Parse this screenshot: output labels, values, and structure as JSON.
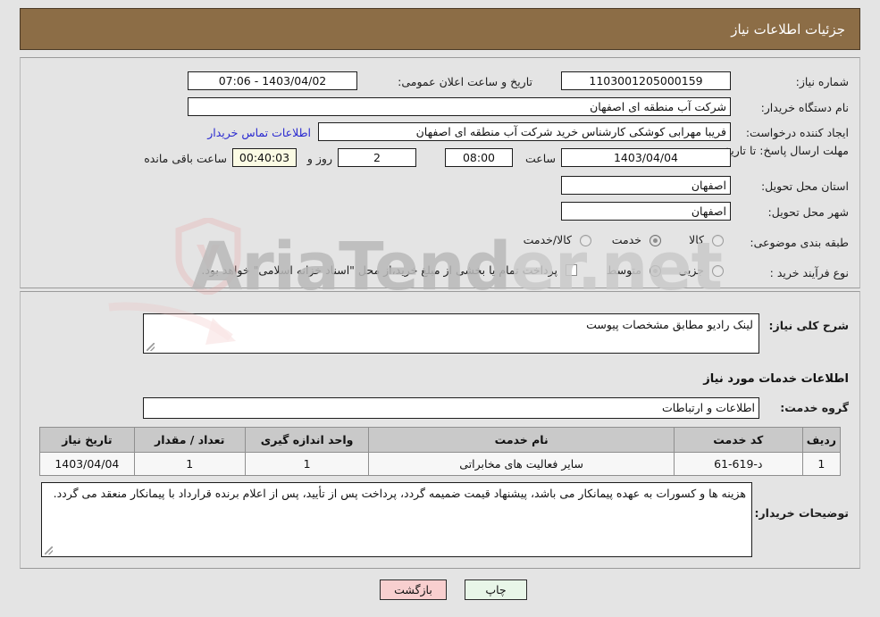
{
  "header": {
    "title": "جزئیات اطلاعات نیاز"
  },
  "top_section": {
    "need_number": {
      "label": "شماره نیاز:",
      "value": "1103001205000159"
    },
    "public_announce": {
      "label": "تاریخ و ساعت اعلان عمومی:",
      "value": "1403/04/02 - 07:06"
    },
    "buyer_org": {
      "label": "نام دستگاه خریدار:",
      "value": "شرکت آب منطقه ای اصفهان"
    },
    "requester": {
      "label": "ایجاد کننده درخواست:",
      "value": "فریبا مهرابی کوشکی کارشناس خرید شرکت آب منطقه ای اصفهان"
    },
    "contact_link": {
      "label": "اطلاعات تماس خریدار"
    },
    "deadline": {
      "label": "مهلت ارسال پاسخ: تا تاریخ:",
      "date": "1403/04/04",
      "time_label": "ساعت",
      "time": "08:00",
      "days": "2",
      "days_label": "روز و",
      "countdown": "00:40:03",
      "remaining_label": "ساعت باقی مانده"
    },
    "province": {
      "label": "استان محل تحویل:",
      "value": "اصفهان"
    },
    "city": {
      "label": "شهر محل تحویل:",
      "value": "اصفهان"
    },
    "category": {
      "label": "طبقه بندی موضوعی:",
      "options": [
        "کالا",
        "خدمت",
        "کالا/خدمت"
      ],
      "selected": "خدمت"
    },
    "process_type": {
      "label": "نوع فرآیند خرید :",
      "options": [
        "جزیی",
        "متوسط"
      ],
      "selected": "متوسط"
    },
    "treasury_note": {
      "text": "پرداخت تمام یا بخشی از مبلغ خرید،از محل \"اسناد خزانه اسلامی\" خواهد بود.",
      "checked": false
    }
  },
  "bottom_section": {
    "general_desc": {
      "label": "شرح کلی نیاز:",
      "value": "لینک رادیو مطابق مشخصات پیوست"
    },
    "services_heading": "اطلاعات خدمات مورد نیاز",
    "service_group": {
      "label": "گروه خدمت:",
      "value": "اطلاعات و ارتباطات"
    },
    "table": {
      "headers": [
        "ردیف",
        "کد خدمت",
        "نام خدمت",
        "واحد اندازه گیری",
        "تعداد / مقدار",
        "تاریخ نیاز"
      ],
      "rows": [
        [
          "1",
          "د-619-61",
          "سایر فعالیت های مخابراتی",
          "1",
          "1",
          "1403/04/04"
        ]
      ]
    },
    "buyer_notes": {
      "label": "توضیحات خریدار:",
      "value": "هزینه ها و کسورات به عهده پیمانکار می باشد، پیشنهاد قیمت ضمیمه گردد، پرداخت پس از تأیید، پس از اعلام برنده قرارداد با پیمانکار منعقد می گردد."
    }
  },
  "footer": {
    "back_button": "بازگشت",
    "print_button": "چاپ"
  },
  "watermark": {
    "text_main": "AriaTend",
    "text_tld": "er.net"
  },
  "colors": {
    "header_bg": "#8c6d46",
    "page_bg": "#e4e4e4",
    "link": "#2a2ad0",
    "countdown_bg": "#fbfbe4",
    "back_btn": "#f8cfcf",
    "print_btn": "#e8f6e8"
  }
}
